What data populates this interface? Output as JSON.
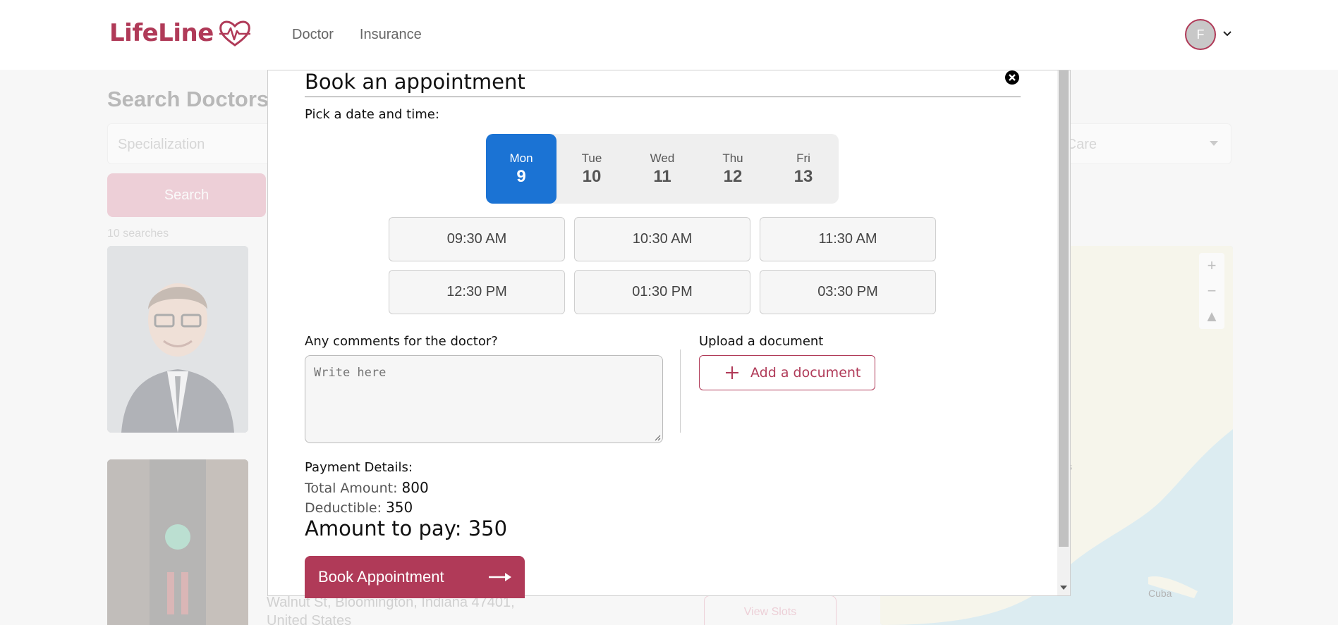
{
  "header": {
    "logo_text": "LifeLine",
    "nav": [
      "Doctor",
      "Insurance"
    ],
    "avatar_initial": "F"
  },
  "background": {
    "title": "Search Doctors",
    "specialization_placeholder": "Specialization",
    "care_select_partial": "d Care",
    "search_button": "Search",
    "count_text": "10 searches",
    "address_line1": "Walnut St, Bloomington, Indiana 47401,",
    "address_line2": "United States",
    "view_slots_button": "View Slots",
    "map_label": "Cuba",
    "map_partial_label": "s"
  },
  "modal": {
    "title": "Book an appointment",
    "pick_label": "Pick a date and time:",
    "days": [
      {
        "name": "Mon",
        "num": "9",
        "selected": true
      },
      {
        "name": "Tue",
        "num": "10",
        "selected": false
      },
      {
        "name": "Wed",
        "num": "11",
        "selected": false
      },
      {
        "name": "Thu",
        "num": "12",
        "selected": false
      },
      {
        "name": "Fri",
        "num": "13",
        "selected": false
      }
    ],
    "slots": [
      "09:30 AM",
      "10:30 AM",
      "11:30 AM",
      "12:30 PM",
      "01:30 PM",
      "03:30 PM"
    ],
    "comments_label": "Any comments for the doctor?",
    "comments_placeholder": "Write here",
    "upload_label": "Upload a document",
    "add_document_button": "Add a document",
    "payment": {
      "title": "Payment Details:",
      "total_label": "Total Amount:",
      "total_value": "800",
      "deductible_label": "Deductible:",
      "deductible_value": "350",
      "amount_to_pay_text": "Amount to pay: 350"
    },
    "book_button": "Book Appointment"
  },
  "colors": {
    "brand": "#b03a58",
    "selected_day": "#1b73d4"
  }
}
